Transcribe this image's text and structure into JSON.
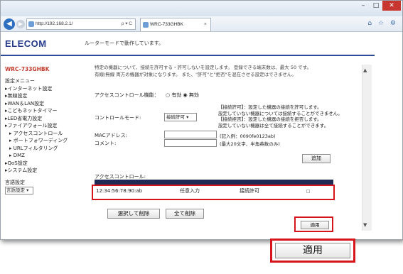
{
  "browser": {
    "address": "http://192.168.2.1/",
    "address_controls": "ρ ▾ C",
    "tab_title": "WRC-733GHBK",
    "tab_close": "×",
    "win_min": "–",
    "win_max": "□",
    "win_close": "✕",
    "back": "◀",
    "forward": "▶",
    "nav_icons": "⌂ ☆ ⚙"
  },
  "header": {
    "brand": "ELECOM",
    "status": "ルーターモードで動作しています。"
  },
  "sidebar": {
    "model": "WRC-733GHBK",
    "items": [
      {
        "label": "設定メニュー",
        "sub": false
      },
      {
        "label": "▸インターネット設定",
        "sub": false
      },
      {
        "label": "▸無線設定",
        "sub": false
      },
      {
        "label": "▸WAN＆LAN設定",
        "sub": false
      },
      {
        "label": "▸こどもネットタイマー",
        "sub": false
      },
      {
        "label": "▸LED省電力設定",
        "sub": false
      },
      {
        "label": "▸ファイアウォール設定",
        "sub": false
      },
      {
        "label": "▸ アクセスコントロール",
        "sub": true
      },
      {
        "label": "▸ ポートフォワーディング",
        "sub": true
      },
      {
        "label": "▸ URLフィルタリング",
        "sub": true
      },
      {
        "label": "▸ DMZ",
        "sub": true
      },
      {
        "label": "▸QoS設定",
        "sub": false
      },
      {
        "label": "▸システム設定",
        "sub": false
      }
    ],
    "language_label": "言語設定",
    "language_value": "言語設定 ▾"
  },
  "content": {
    "intro_line1": "特定の機器について、接続を許可する・許可しないを設定します。 登録できる端末数は、最大 50 です。",
    "intro_line2": "有線/無線 両方の機器が対象になります。 また、\"許可\"と\"拒否\"を混在させる設定はできません。",
    "access_control_label": "アクセスコントロール機能：",
    "radio_options": "○ 有効 ◉ 無効",
    "mode_label": "コントロールモード:",
    "mode_value": "接続許可 ▾",
    "help_lines": [
      "【接続許可】：設定した機器の接続を許可します。",
      "設定していない機器については接続することができません。",
      "【接続拒否】：設定した機器の接続を拒否します。",
      "設定していない機器は全て接続することができます。"
    ],
    "mac_label": "MACアドレス:",
    "mac_hint": "(記入例：0090fe0123ab)",
    "comment_label": "コメント:",
    "comment_hint": "(最大20文字、半角英数のみ)",
    "add_button": "追加",
    "table_title": "アクセスコントロール:",
    "table_row": {
      "mac": "12:34:56:78:90:ab",
      "comment": "任意入力",
      "status": "接続許可"
    },
    "delete_selected_button": "選択して削除",
    "delete_all_button": "全て削除",
    "apply_button": "適用"
  },
  "callout": {
    "apply_label": "適用"
  },
  "scrollbar": {
    "up": "▲",
    "down": "▼"
  }
}
